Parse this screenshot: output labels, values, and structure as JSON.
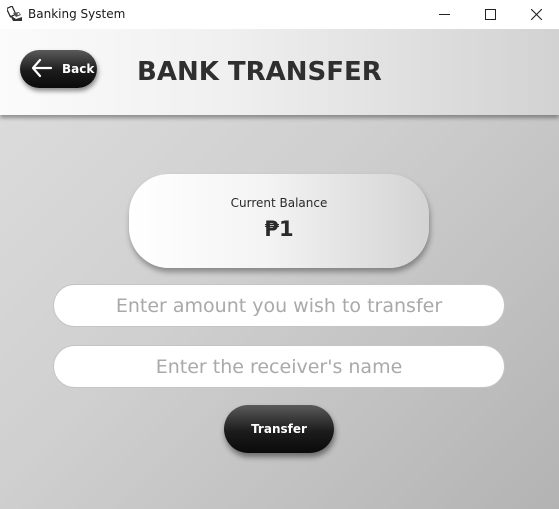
{
  "window": {
    "title": "Banking System",
    "app_icon": "atm-card-icon",
    "controls": [
      "minimize-icon",
      "maximize-icon",
      "close-icon"
    ]
  },
  "header": {
    "back_label": "Back",
    "back_icon": "arrow-left-icon",
    "title": "BANK TRANSFER"
  },
  "balance": {
    "label": "Current Balance",
    "value": "₱1"
  },
  "form": {
    "amount": {
      "value": "",
      "placeholder": "Enter amount you wish to transfer"
    },
    "receiver": {
      "value": "",
      "placeholder": "Enter the receiver's name"
    },
    "submit_label": "Transfer"
  },
  "colors": {
    "title_text": "#2f2f2f",
    "button_dark": "#1c1c1c",
    "button_text": "#ffffff",
    "placeholder": "#a9a9a9"
  }
}
